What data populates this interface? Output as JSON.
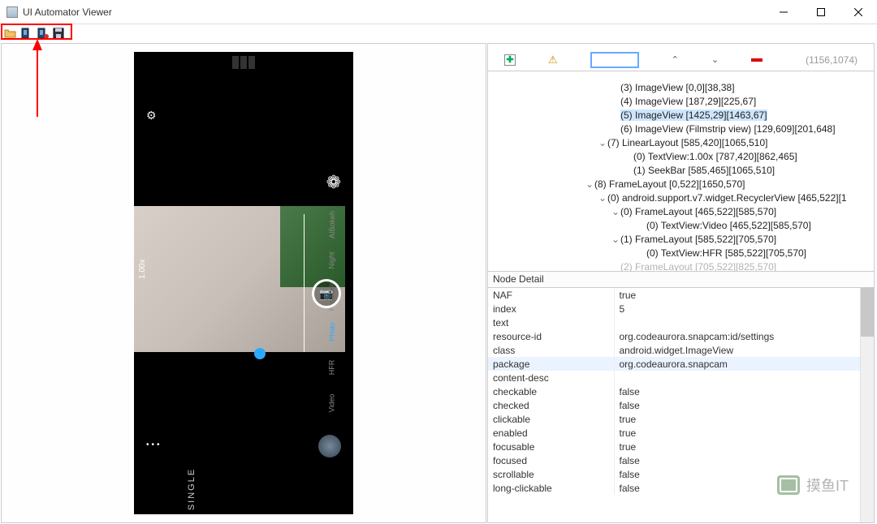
{
  "title": "UI Automator Viewer",
  "toolbar_coord": "(1156,1074)",
  "device": {
    "zoom": "1.00x",
    "modes": [
      "AIBokeh",
      "Night",
      "ProMode",
      "Photo",
      "HFR",
      "Video"
    ],
    "active_mode": "Photo",
    "bottom": "SINGLE",
    "dots": "•••"
  },
  "tree": [
    {
      "indent": 9,
      "toggle": "",
      "label": "(3) ImageView [0,0][38,38]"
    },
    {
      "indent": 9,
      "toggle": "",
      "label": "(4) ImageView [187,29][225,67]"
    },
    {
      "indent": 9,
      "toggle": "",
      "label": "(5) ImageView [1425,29][1463,67]",
      "selected": true
    },
    {
      "indent": 9,
      "toggle": "",
      "label": "(6) ImageView (Filmstrip view) [129,609][201,648]"
    },
    {
      "indent": 8,
      "toggle": "⌄",
      "label": "(7) LinearLayout [585,420][1065,510]"
    },
    {
      "indent": 10,
      "toggle": "",
      "label": "(0) TextView:1.00x [787,420][862,465]"
    },
    {
      "indent": 10,
      "toggle": "",
      "label": "(1) SeekBar [585,465][1065,510]"
    },
    {
      "indent": 7,
      "toggle": "⌄",
      "label": "(8) FrameLayout [0,522][1650,570]"
    },
    {
      "indent": 8,
      "toggle": "⌄",
      "label": "(0) android.support.v7.widget.RecyclerView [465,522][1"
    },
    {
      "indent": 9,
      "toggle": "⌄",
      "label": "(0) FrameLayout [465,522][585,570]"
    },
    {
      "indent": 11,
      "toggle": "",
      "label": "(0) TextView:Video [465,522][585,570]"
    },
    {
      "indent": 9,
      "toggle": "⌄",
      "label": "(1) FrameLayout [585,522][705,570]"
    },
    {
      "indent": 11,
      "toggle": "",
      "label": "(0) TextView:HFR [585,522][705,570]"
    },
    {
      "indent": 9,
      "toggle": "",
      "label": "(2) FrameLayout [705,522][825,570]",
      "faded": true
    }
  ],
  "detail_header": "Node Detail",
  "details": [
    {
      "k": "NAF",
      "v": "true"
    },
    {
      "k": "index",
      "v": "5"
    },
    {
      "k": "text",
      "v": ""
    },
    {
      "k": "resource-id",
      "v": "org.codeaurora.snapcam:id/settings"
    },
    {
      "k": "class",
      "v": "android.widget.ImageView"
    },
    {
      "k": "package",
      "v": "org.codeaurora.snapcam",
      "hl": true
    },
    {
      "k": "content-desc",
      "v": ""
    },
    {
      "k": "checkable",
      "v": "false"
    },
    {
      "k": "checked",
      "v": "false"
    },
    {
      "k": "clickable",
      "v": "true"
    },
    {
      "k": "enabled",
      "v": "true"
    },
    {
      "k": "focusable",
      "v": "true"
    },
    {
      "k": "focused",
      "v": "false"
    },
    {
      "k": "scrollable",
      "v": "false"
    },
    {
      "k": "long-clickable",
      "v": "false"
    }
  ],
  "watermark": "摸鱼IT"
}
